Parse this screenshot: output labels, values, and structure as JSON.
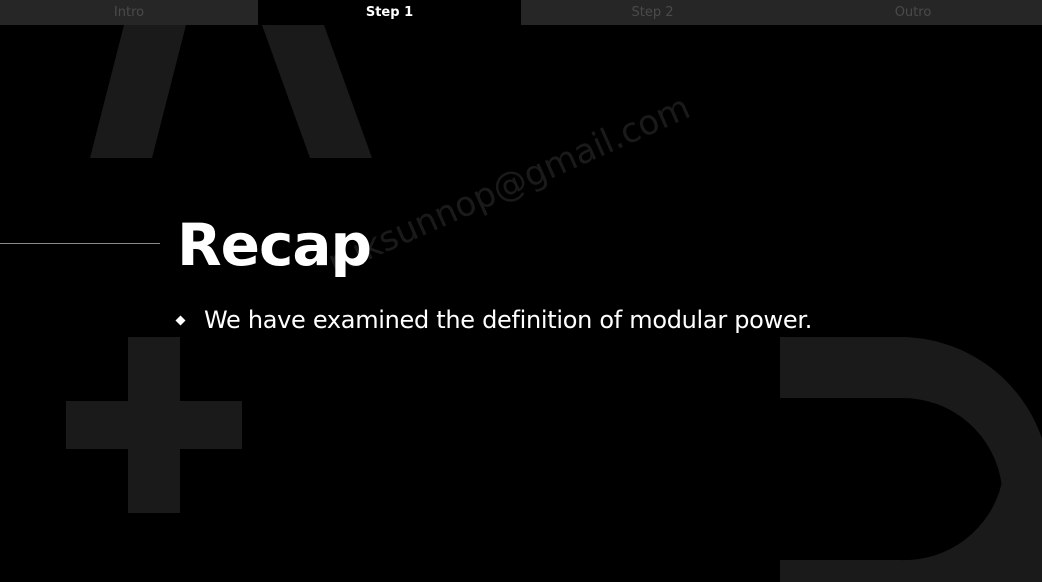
{
  "tabs": [
    {
      "label": "Intro",
      "active": false
    },
    {
      "label": "Step 1",
      "active": true
    },
    {
      "label": "Step 2",
      "active": false
    },
    {
      "label": "Outro",
      "active": false
    }
  ],
  "slide": {
    "title": "Recap",
    "bullets": [
      "We have examined the definition of modular power."
    ],
    "watermark": "ruksunnop@gmail.com"
  },
  "colors": {
    "background": "#000000",
    "tab_bar": "#262626",
    "tab_inactive_text": "#4a4a4a",
    "tab_active_text": "#ffffff",
    "text": "#ffffff",
    "decoration": "#1a1a1a"
  }
}
